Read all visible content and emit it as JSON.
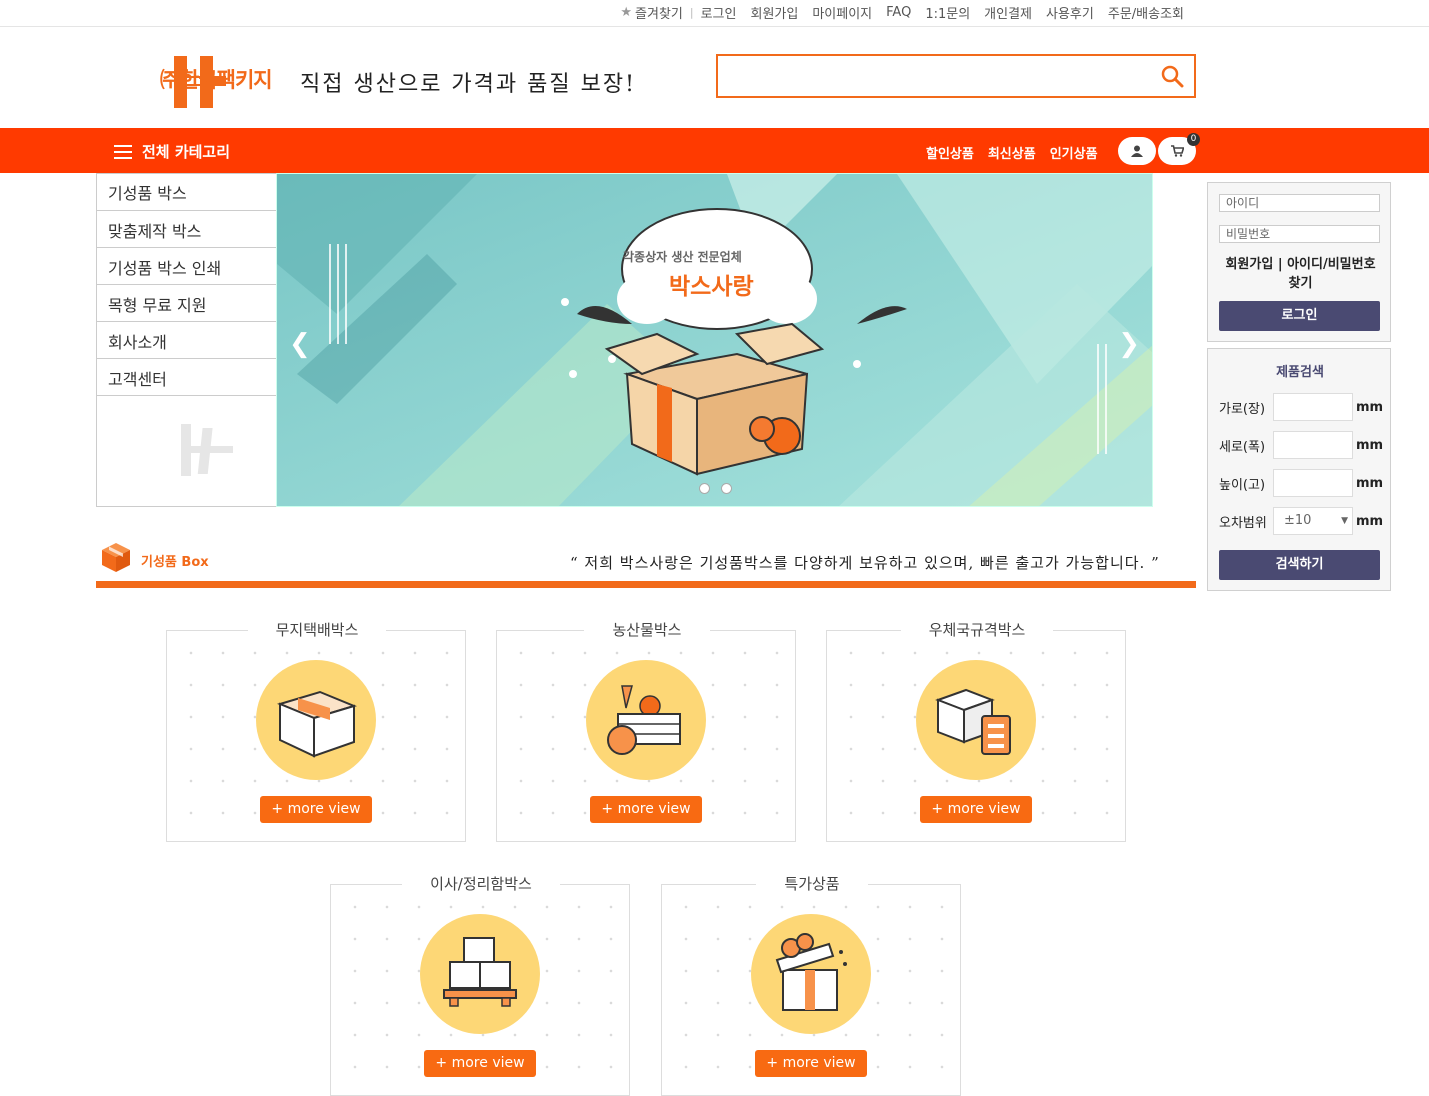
{
  "topbar": {
    "links": [
      "즐겨찾기",
      "로그인",
      "회원가입",
      "마이페이지",
      "FAQ",
      "1:1문의",
      "개인결제",
      "사용후기",
      "주문/배송조회"
    ]
  },
  "header": {
    "logo_text": "㈜한국팩키지",
    "slogan": "직접 생산으로 가격과 품질 보장!",
    "search_placeholder": ""
  },
  "nav": {
    "category_label": "전체 카테고리",
    "links": [
      "할인상품",
      "최신상품",
      "인기상품"
    ],
    "cart_count": "0"
  },
  "category_menu": [
    "기성품 박스",
    "맞춤제작 박스",
    "기성품 박스 인쇄",
    "목형 무료 지원",
    "회사소개",
    "고객센터"
  ],
  "banner": {
    "subtitle": "각종상자 생산 전문업체",
    "title": "박스사랑"
  },
  "login": {
    "id_placeholder": "아이디",
    "pw_placeholder": "비밀번호",
    "join": "회원가입",
    "find": "아이디/비밀번호 찾기",
    "button": "로그인"
  },
  "product_search": {
    "title": "제품검색",
    "rows": [
      {
        "label": "가로(장)",
        "value": "",
        "unit": "mm"
      },
      {
        "label": "세로(폭)",
        "value": "",
        "unit": "mm"
      },
      {
        "label": "높이(고)",
        "value": "",
        "unit": "mm"
      }
    ],
    "tolerance_label": "오차범위",
    "tolerance_value": "±10",
    "tolerance_unit": "mm",
    "button": "검색하기"
  },
  "section": {
    "title": "기성품 Box",
    "quote": "“ 저희 박스사랑은 기성품박스를 다양하게 보유하고 있으며, 빠른 출고가 가능합니다. ”"
  },
  "cards": [
    {
      "title": "무지택배박스",
      "button": "+ more view",
      "icon": "box-icon"
    },
    {
      "title": "농산물박스",
      "button": "+ more view",
      "icon": "produce-crate-icon"
    },
    {
      "title": "우체국규격박스",
      "button": "+ more view",
      "icon": "box-checklist-icon"
    },
    {
      "title": "이사/정리함박스",
      "button": "+ more view",
      "icon": "pallet-boxes-icon"
    },
    {
      "title": "특가상품",
      "button": "+ more view",
      "icon": "gift-box-icon"
    }
  ],
  "colors": {
    "accent": "#ff3a00",
    "brand_orange": "#f26a1a",
    "navy": "#4a4a72",
    "circle": "#fdd776"
  }
}
